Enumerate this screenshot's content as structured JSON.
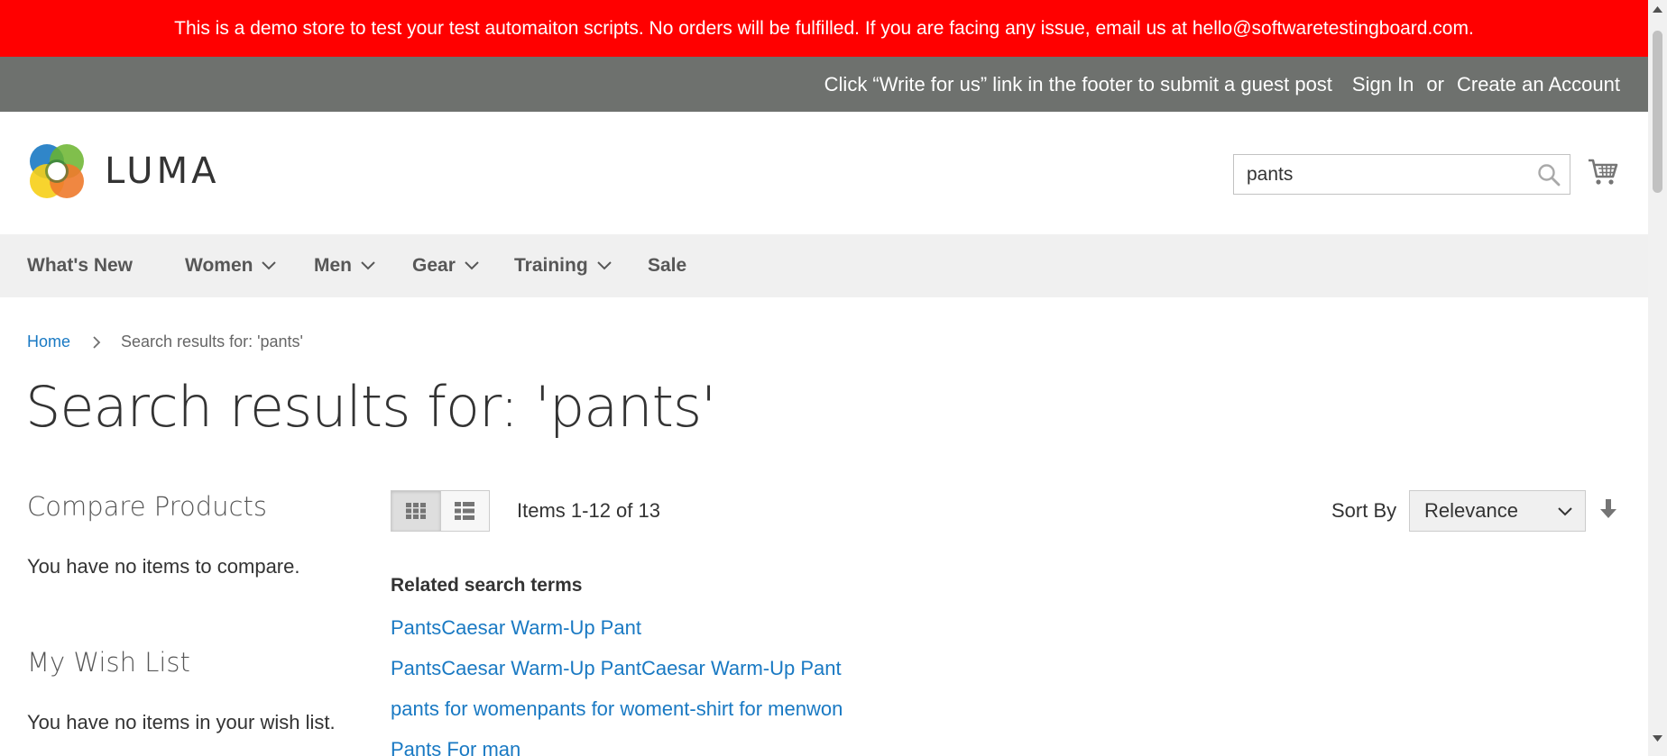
{
  "demo_banner": {
    "text": "This is a demo store to test your test automaiton scripts. No orders will be fulfilled. If you are facing any issue, email us at hello@softwaretestingboard.com."
  },
  "topbar": {
    "guest_post": "Click “Write for us” link in the footer to submit a guest post",
    "sign_in": "Sign In",
    "or": "or",
    "create_account": "Create an Account"
  },
  "header": {
    "logo_text": "LUMA",
    "search_value": "pants"
  },
  "nav": {
    "items": [
      {
        "label": "What's New"
      },
      {
        "label": "Women"
      },
      {
        "label": "Men"
      },
      {
        "label": "Gear"
      },
      {
        "label": "Training"
      },
      {
        "label": "Sale"
      }
    ]
  },
  "breadcrumb": {
    "home": "Home",
    "current": "Search results for: 'pants'"
  },
  "page_title": "Search results for: 'pants'",
  "sidebar": {
    "compare_title": "Compare Products",
    "compare_text": "You have no items to compare.",
    "wishlist_title": "My Wish List",
    "wishlist_text": "You have no items in your wish list."
  },
  "toolbar": {
    "items_count": "Items 1-12 of 13",
    "sort_label": "Sort By",
    "sort_value": "Relevance"
  },
  "related": {
    "title": "Related search terms",
    "terms": [
      "PantsCaesar Warm-Up Pant",
      "PantsCaesar Warm-Up PantCaesar Warm-Up Pant",
      "pants for womenpants for woment-shirt for menwon",
      "Pants For man"
    ]
  },
  "colors": {
    "banner_bg": "#ff0000",
    "topbar_bg": "#6e716e",
    "nav_bg": "#f0f0f0",
    "link": "#1979c3"
  }
}
